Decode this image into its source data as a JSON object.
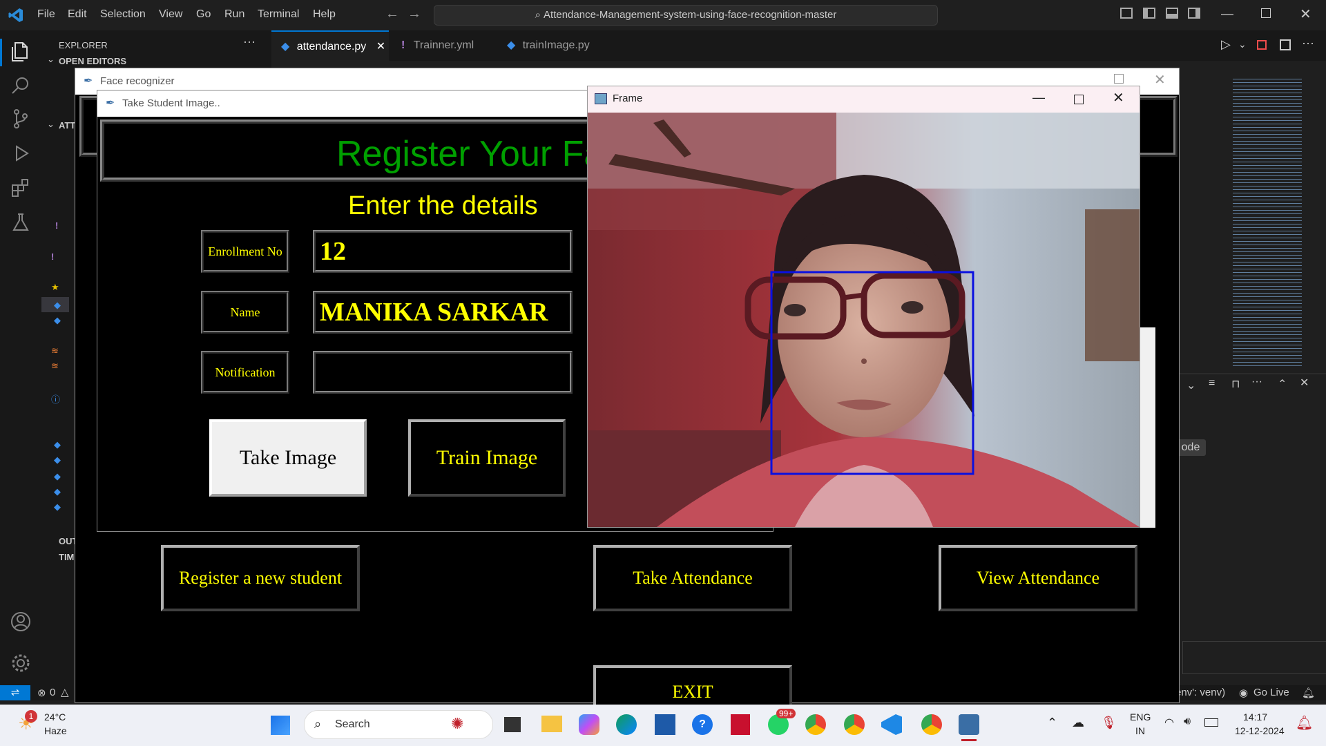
{
  "vscode": {
    "menu": [
      "File",
      "Edit",
      "Selection",
      "View",
      "Go",
      "Run",
      "Terminal",
      "Help"
    ],
    "search": "Attendance-Management-system-using-face-recognition-master",
    "sidebar_title": "EXPLORER",
    "open_editors": "OPEN EDITORS",
    "section_att": "ATT",
    "outline": "OUT",
    "timeline": "TIM",
    "tabs": [
      "attendance.py",
      "Trainner.yml",
      "trainImage.py"
    ],
    "status_left": "0",
    "status_env": "env': venv)",
    "go_live": "Go Live",
    "mode_badge": "ode"
  },
  "face_recognizer": {
    "window_title": "Face recognizer",
    "register_button": "Register a new student",
    "take_attendance_button": "Take Attendance",
    "view_attendance_button": "View Attendance",
    "exit_button": "EXIT"
  },
  "take_student_image": {
    "window_title": "Take Student Image..",
    "heading": "Register Your Fa",
    "subheading": "Enter the details",
    "enrollment_label": "Enrollment No",
    "enrollment_value": "12",
    "name_label": "Name",
    "name_value": "MANIKA SARKAR",
    "notification_label": "Notification",
    "notification_value": "",
    "take_image_button": "Take Image",
    "train_image_button": "Train Image"
  },
  "frame": {
    "window_title": "Frame"
  },
  "taskbar": {
    "weather_temp": "24°C",
    "weather_desc": "Haze",
    "weather_badge": "1",
    "search": "Search",
    "whatsapp_badge": "99+",
    "lang1": "ENG",
    "lang2": "IN",
    "time": "14:17",
    "date": "12-12-2024"
  },
  "colors": {
    "tk_yellow": "#ffff00",
    "tk_green": "#00a000",
    "face_box": "#0a10e0",
    "vscode_accent": "#0078d4"
  }
}
